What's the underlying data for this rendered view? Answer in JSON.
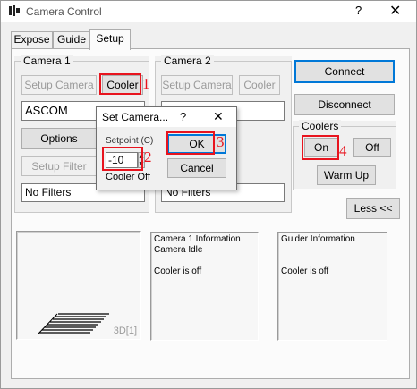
{
  "window": {
    "title": "Camera Control",
    "help_glyph": "?",
    "close_glyph": "✕"
  },
  "tabs": [
    {
      "label": "Expose",
      "active": false
    },
    {
      "label": "Guide",
      "active": false
    },
    {
      "label": "Setup",
      "active": true
    }
  ],
  "camera1": {
    "group_label": "Camera 1",
    "setup_camera_label": "Setup Camera",
    "cooler_label": "Cooler",
    "camera_field": "ASCOM",
    "options_label": "Options",
    "setup_filter_label": "Setup Filter",
    "filter_field": "No Filters"
  },
  "camera2": {
    "group_label": "Camera 2",
    "setup_camera_label": "Setup Camera",
    "cooler_label": "Cooler",
    "camera_field": "No C",
    "filter_field": "No Filters"
  },
  "connection": {
    "connect_label": "Connect",
    "disconnect_label": "Disconnect"
  },
  "coolers": {
    "group_label": "Coolers",
    "on_label": "On",
    "off_label": "Off",
    "warmup_label": "Warm Up"
  },
  "less_label": "Less <<",
  "preview": {
    "caption": "3D[1]"
  },
  "camera1_info": {
    "lines": [
      "Camera 1 Information",
      "Camera Idle",
      "",
      "Cooler is off"
    ]
  },
  "guider_info": {
    "lines": [
      "Guider Information",
      "",
      "",
      "Cooler is off"
    ]
  },
  "dialog": {
    "title": "Set Camera...",
    "help_glyph": "?",
    "close_glyph": "✕",
    "setpoint_label": "Setpoint (C)",
    "setpoint_value": "-10",
    "ok_label": "OK",
    "cancel_label": "Cancel",
    "status_label": "Cooler Off"
  },
  "annotations": {
    "step1": "1",
    "step2": "2",
    "step3": "3",
    "step4": "4",
    "color": "#e8141e"
  }
}
